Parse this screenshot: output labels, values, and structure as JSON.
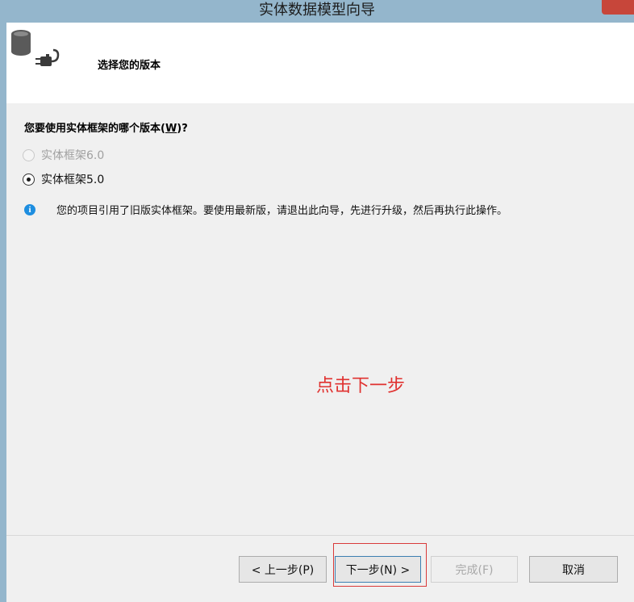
{
  "window": {
    "title": "实体数据模型向导"
  },
  "header": {
    "title": "选择您的版本"
  },
  "question": {
    "text": "您要使用实体框架的哪个版本(",
    "key": "W",
    "suffix": ")?"
  },
  "options": [
    {
      "label": "实体框架6.0",
      "selected": false,
      "enabled": false
    },
    {
      "label": "实体框架5.0",
      "selected": true,
      "enabled": true
    }
  ],
  "info": {
    "icon": "i",
    "text": "您的项目引用了旧版实体框架。要使用最新版，请退出此向导，先进行升级，然后再执行此操作。"
  },
  "annotation": {
    "text": "点击下一步",
    "color": "#e0312f"
  },
  "buttons": {
    "prev": "< 上一步(P)",
    "next": "下一步(N) >",
    "finish": "完成(F)",
    "cancel": "取消"
  }
}
